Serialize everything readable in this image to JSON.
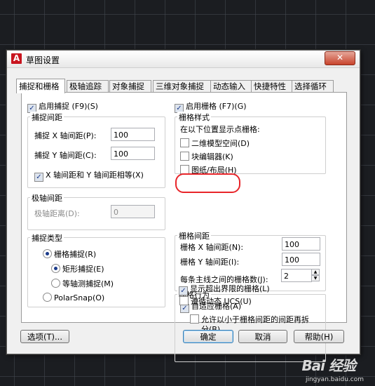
{
  "dialog": {
    "title": "草图设置",
    "app_icon": "A",
    "close": "✕"
  },
  "tabs": [
    "捕捉和栅格",
    "极轴追踪",
    "对象捕捉",
    "三维对象捕捉",
    "动态输入",
    "快捷特性",
    "选择循环"
  ],
  "snap": {
    "enable_label": "启用捕捉 (F9)(S)",
    "enable_checked": true,
    "spacing_title": "捕捉间距",
    "x_label": "捕捉 X 轴间距(P):",
    "x_value": "100",
    "y_label": "捕捉 Y 轴间距(C):",
    "y_value": "100",
    "equal_label": "X 轴间距和 Y 轴间距相等(X)",
    "equal_checked": true
  },
  "polar": {
    "title": "极轴间距",
    "distance_label": "极轴距离(D):",
    "distance_value": "0"
  },
  "snap_type": {
    "title": "捕捉类型",
    "grid_snap": "栅格捕捉(R)",
    "rect_snap": "矩形捕捉(E)",
    "iso_snap": "等轴测捕捉(M)",
    "polar_snap": "PolarSnap(O)"
  },
  "grid": {
    "enable_label": "启用栅格  (F7)(G)",
    "enable_checked": true,
    "style_title": "栅格样式",
    "style_subtitle": "在以下位置显示点栅格:",
    "style_2d": "二维模型空间(D)",
    "style_block": "块编辑器(K)",
    "style_sheet": "图纸/布局(H)",
    "spacing_title": "栅格间距",
    "x_label": "栅格 X 轴间距(N):",
    "x_value": "100",
    "y_label": "栅格 Y 轴间距(I):",
    "y_value": "100",
    "major_label": "每条主线之间的栅格数(J):",
    "major_value": "2",
    "behavior_title": "栅格行为",
    "adaptive": "自适应栅格(A)",
    "subdivide_line1": "允许以小于栅格间距的间距再拆",
    "subdivide_line2": "分(B)",
    "beyond": "显示超出界限的栅格(L)",
    "follow_ucs": "遵循动态 UCS(U)"
  },
  "buttons": {
    "options": "选项(T)...",
    "ok": "确定",
    "cancel": "取消",
    "help": "帮助(H)"
  },
  "watermark": {
    "brand": "Bai 经验",
    "url": "jingyan.baidu.com"
  },
  "icons": {
    "check": "✓",
    "spin_up": "▲",
    "spin_down": "▼"
  }
}
